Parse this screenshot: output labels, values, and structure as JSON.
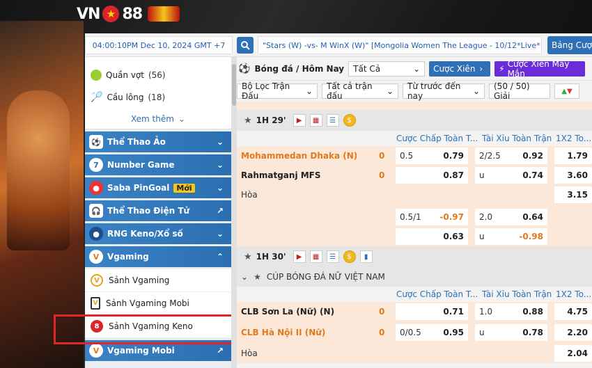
{
  "logo": {
    "text": "VN88"
  },
  "topbar": {
    "time": "04:00:10PM Dec 10, 2024 GMT +7",
    "marquee": "\"Stars (W) -vs- M WinX (W)\" [Mongolia Women The League - 10/12*Live*]",
    "bang_cuoc": "Bảng Cược"
  },
  "sidebar": {
    "sports": [
      {
        "label": "Quần vợt",
        "count": "(56)"
      },
      {
        "label": "Cầu lông",
        "count": "(18)"
      }
    ],
    "xem_them": "Xem thêm",
    "categories": [
      {
        "label": "Thể Thao Ảo"
      },
      {
        "label": "Number Game"
      },
      {
        "label": "Saba PinGoal",
        "badge": "Mới"
      },
      {
        "label": "Thể Thao Điện Tử"
      },
      {
        "label": "RNG Keno/Xổ số"
      },
      {
        "label": "Vgaming"
      }
    ],
    "vgaming_items": [
      {
        "label": "Sảnh Vgaming"
      },
      {
        "label": "Sảnh Vgaming Mobi"
      },
      {
        "label": "Sảnh Vgaming Keno"
      }
    ],
    "bottom_category": {
      "label": "Vgaming Mobi"
    }
  },
  "main": {
    "title": "Bóng đá / Hôm Nay",
    "select_all": "Tất Cả",
    "cuoc_xien": "Cược Xiên",
    "cuoc_xien_may_man": "Cược Xiên May Mắn",
    "filters": {
      "bo_loc": "Bộ Lọc Trận Đấu",
      "tat_ca_tran": "Tất cả trận đấu",
      "tu_truoc": "Từ trước đến nay",
      "giai": "(50 / 50) Giải"
    },
    "headers": {
      "handicap": "Cược Chấp Toàn T...",
      "overunder": "Tài Xỉu Toàn Trận",
      "x12": "1X2 To..."
    },
    "live1": {
      "time": "1H 29'"
    },
    "match1": {
      "home": "Mohammedan Dhaka (N)",
      "away": "Rahmatganj MFS",
      "draw": "Hòa",
      "home_score": "0",
      "away_score": "0",
      "odds": {
        "r1": {
          "hcp": "0.5",
          "hcp_odd": "0.79",
          "ou": "2/2.5",
          "ou_odd": "0.92",
          "x12": "1.79"
        },
        "r2": {
          "hcp_odd": "0.87",
          "ou": "u",
          "ou_odd": "0.74",
          "x12": "3.60"
        },
        "r3": {
          "x12": "3.15"
        },
        "r4": {
          "hcp": "0.5/1",
          "hcp_odd": "-0.97",
          "ou": "2.0",
          "ou_odd": "0.64"
        },
        "r5": {
          "hcp_odd": "0.63",
          "ou": "u",
          "ou_odd": "-0.98"
        }
      }
    },
    "live2": {
      "time": "1H 30'"
    },
    "league": "CÚP BÓNG ĐÁ NỮ VIỆT NAM",
    "match2": {
      "home": "CLB Sơn La (Nữ) (N)",
      "away": "CLB Hà Nội II (Nữ)",
      "draw": "Hòa",
      "home_score": "0",
      "away_score": "0",
      "odds": {
        "r1": {
          "hcp_odd": "0.71",
          "ou": "1.0",
          "ou_odd": "0.88",
          "x12": "4.75"
        },
        "r2": {
          "hcp": "0/0.5",
          "hcp_odd": "0.95",
          "ou": "u",
          "ou_odd": "0.78",
          "x12": "2.20"
        },
        "r3": {
          "x12": "2.04"
        }
      }
    }
  }
}
